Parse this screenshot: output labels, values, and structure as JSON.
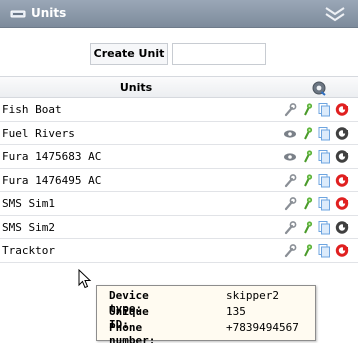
{
  "window": {
    "title": "Units",
    "title_icon": "unit-icon",
    "collapse_icon": "double-chevron-icon"
  },
  "create": {
    "label": "Create Unit",
    "input_value": "",
    "input_placeholder": ""
  },
  "table": {
    "header_title": "Units",
    "header_icon": "settings-gear-icon",
    "rows": [
      {
        "name": "Fish Boat",
        "actions": [
          "wrench-icon",
          "map-pin-icon",
          "copy-icon",
          "delete-icon"
        ],
        "delete_color": "#e02020"
      },
      {
        "name": "Fuel Rivers",
        "actions": [
          "eye-icon",
          "map-pin-icon",
          "copy-icon",
          "delete-icon"
        ],
        "delete_color": "#404040"
      },
      {
        "name": "Fura 1475683 AC",
        "actions": [
          "eye-icon",
          "map-pin-icon",
          "copy-icon",
          "delete-icon"
        ],
        "delete_color": "#404040"
      },
      {
        "name": "Fura 1476495 AC",
        "actions": [
          "wrench-icon",
          "map-pin-icon",
          "copy-icon",
          "delete-icon"
        ],
        "delete_color": "#e02020"
      },
      {
        "name": "SMS Sim1",
        "actions": [
          "wrench-icon",
          "map-pin-icon",
          "copy-icon",
          "delete-icon"
        ],
        "delete_color": "#e02020"
      },
      {
        "name": "SMS Sim2",
        "actions": [
          "wrench-icon",
          "map-pin-icon",
          "copy-icon",
          "delete-icon"
        ],
        "delete_color": "#404040"
      },
      {
        "name": "Tracktor",
        "actions": [
          "wrench-icon",
          "map-pin-icon",
          "copy-icon",
          "delete-icon"
        ],
        "delete_color": "#e02020"
      }
    ]
  },
  "tooltip": {
    "device_type_label": "Device type:",
    "device_type_value": "skipper2",
    "unique_id_label": "Unique ID:",
    "unique_id_value": "135",
    "phone_label": "Phone number:",
    "phone_value": "+7839494567"
  },
  "colors": {
    "titlebar": "#8795a7",
    "delete_red": "#e02020",
    "delete_grey": "#404040",
    "pin_green": "#4a9a2a",
    "copy_blue": "#6ea5e0"
  }
}
